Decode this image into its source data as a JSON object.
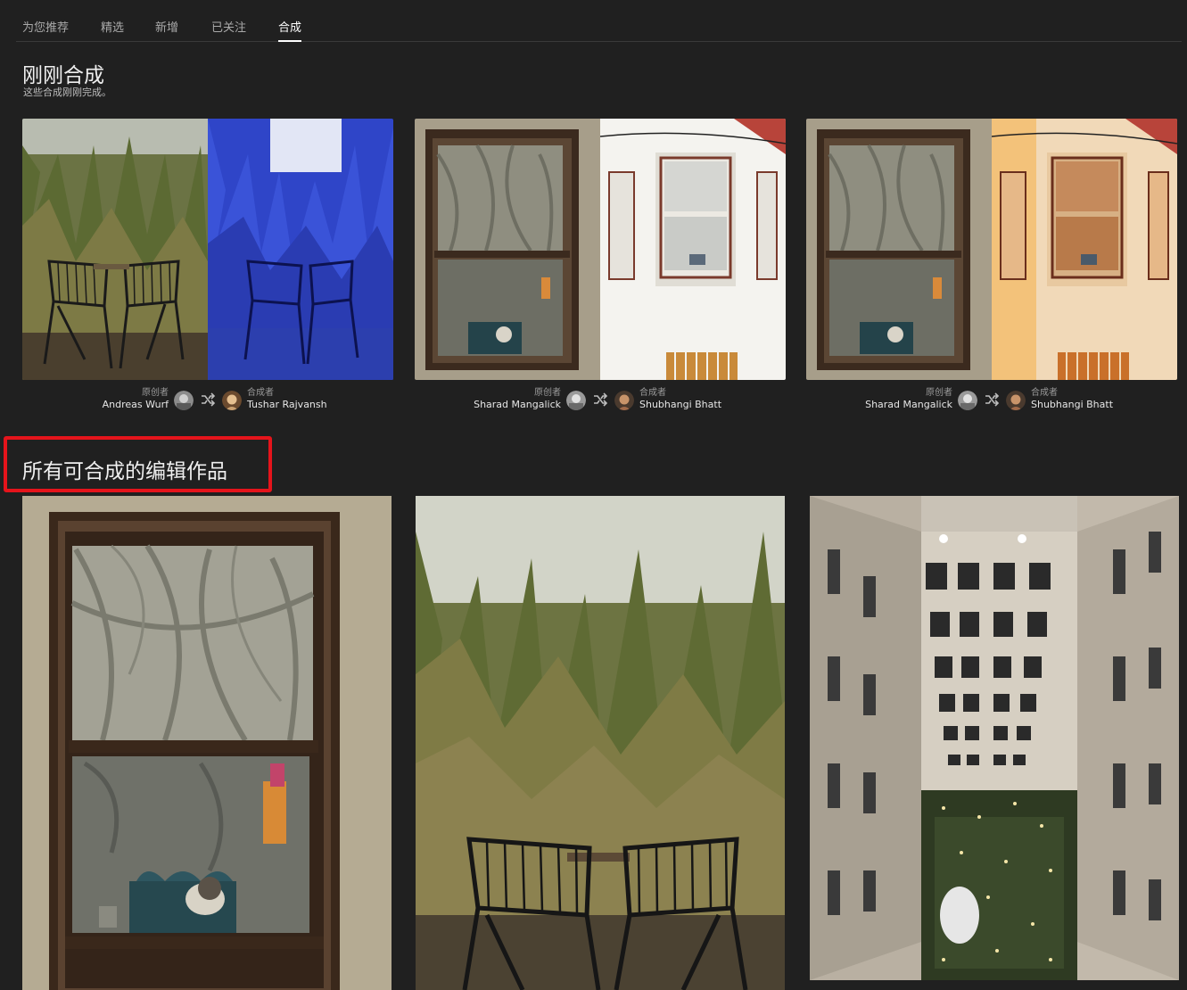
{
  "tabs": [
    {
      "label": "为您推荐"
    },
    {
      "label": "精选"
    },
    {
      "label": "新增"
    },
    {
      "label": "已关注"
    },
    {
      "label": "合成"
    }
  ],
  "recent": {
    "title": "刚刚合成",
    "subtitle": "这些合成刚刚完成。",
    "cards": [
      {
        "original_role": "原创者",
        "original_name": "Andreas Wurf",
        "remixer_role": "合成者",
        "remixer_name": "Tushar Rajvansh"
      },
      {
        "original_role": "原创者",
        "original_name": "Sharad Mangalick",
        "remixer_role": "合成者",
        "remixer_name": "Shubhangi Bhatt"
      },
      {
        "original_role": "原创者",
        "original_name": "Sharad Mangalick",
        "remixer_role": "合成者",
        "remixer_name": "Shubhangi Bhatt"
      }
    ]
  },
  "remixable": {
    "title": "所有可合成的编辑作品"
  },
  "colors": {
    "background": "#202020",
    "highlight": "#e5141b",
    "active_tab": "#ffffff"
  }
}
